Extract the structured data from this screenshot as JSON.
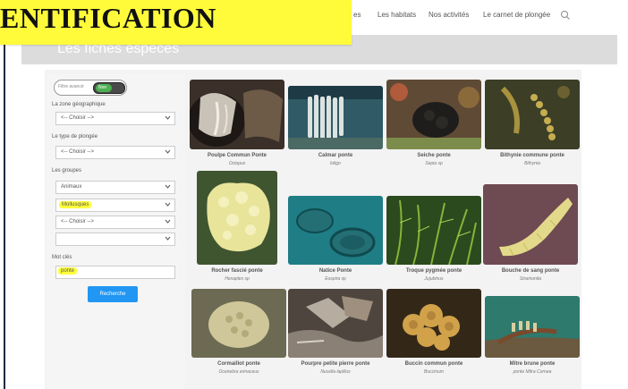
{
  "banner": {
    "text": "ENTIFICATION"
  },
  "nav": {
    "items": [
      "es",
      "Les habitats",
      "Nos activités",
      "Le carnet de plongée"
    ],
    "search_icon": "search-icon"
  },
  "page": {
    "title": "Les fiches espèces"
  },
  "sidebar": {
    "toggle_label": "Filtre avancé",
    "toggle_state": "Non",
    "zone_label": "La zone géographique",
    "zone_value": "<-- Choisir -->",
    "dive_type_label": "Le type de plongée",
    "dive_type_value": "<-- Choisir -->",
    "groups_label": "Les groupes",
    "group_1": "Animaux",
    "group_2": "Mollusques",
    "group_3": "<-- Choisir -->",
    "group_4": "",
    "keywords_label": "Mot clés",
    "keywords_value": "ponte",
    "search_button": "Recherche"
  },
  "species": [
    {
      "name": "Poulpe Commun Ponte",
      "sci": "Octopus"
    },
    {
      "name": "Calmar ponte",
      "sci": "loligo"
    },
    {
      "name": "Seiche ponte",
      "sci": "Sepia sp"
    },
    {
      "name": "Bithynie commune ponte",
      "sci": "Bithynia"
    },
    {
      "name": "Rocher fascié ponte",
      "sci": "Hexaplex sp"
    },
    {
      "name": "Natice Ponte",
      "sci": "Euspira sp"
    },
    {
      "name": "Troque pygmée ponte",
      "sci": "Jujubinus"
    },
    {
      "name": "Bouche de sang ponte",
      "sci": "Stramonita"
    },
    {
      "name": "Cormaillot ponte",
      "sci": "Ocenebra erinaceus"
    },
    {
      "name": "Pourpre petite pierre ponte",
      "sci": "Nucella lapillus"
    },
    {
      "name": "Buccin commun ponte",
      "sci": "Buccinum"
    },
    {
      "name": "Mitre brune ponte",
      "sci": "ponte Mitra Cornea"
    }
  ],
  "colors": {
    "accent_button": "#2196f3",
    "highlight": "#ffff3c",
    "toggle_on": "#4caf50"
  }
}
